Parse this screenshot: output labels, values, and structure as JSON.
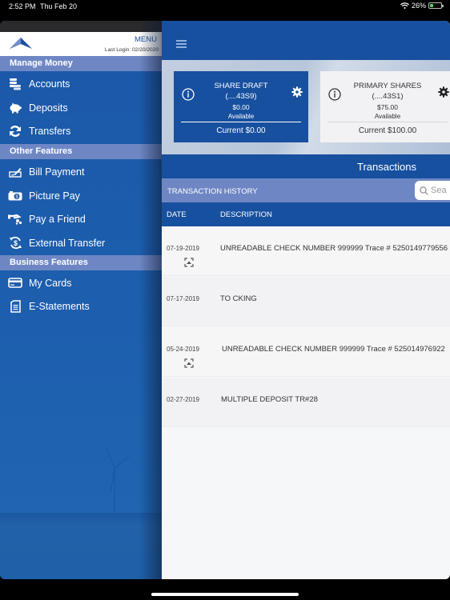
{
  "status_bar": {
    "time": "2:52 PM",
    "date": "Thu Feb 20",
    "battery_percent": "26%",
    "battery_level": 0.26,
    "icons": [
      "wifi-icon",
      "battery-charging-icon"
    ]
  },
  "sidebar": {
    "menu_label": "MENU",
    "last_login": "Last Login:  02/20/2020",
    "sections": [
      {
        "title": "Manage Money",
        "items": [
          {
            "label": "Accounts",
            "icon": "coins-stack-icon"
          },
          {
            "label": "Deposits",
            "icon": "piggy-bank-icon"
          },
          {
            "label": "Transfers",
            "icon": "sync-arrows-icon"
          }
        ]
      },
      {
        "title": "Other Features",
        "items": [
          {
            "label": "Bill Payment",
            "icon": "signing-check-icon"
          },
          {
            "label": "Picture Pay",
            "icon": "camera-money-icon"
          },
          {
            "label": "Pay a Friend",
            "icon": "hand-coins-icon"
          },
          {
            "label": "External Transfer",
            "icon": "dollar-cycle-icon"
          }
        ]
      },
      {
        "title": "Business Features",
        "items": [
          {
            "label": "My Cards",
            "icon": "credit-card-icon"
          },
          {
            "label": "E-Statements",
            "icon": "document-icon"
          }
        ]
      }
    ]
  },
  "main": {
    "menu_icon": "hamburger-icon",
    "accounts": [
      {
        "name": "SHARE DRAFT",
        "number": "(....43S9)",
        "available_amount": "$0.00",
        "available_label": "Available",
        "current": "Current $0.00",
        "selected": true
      },
      {
        "name": "PRIMARY SHARES",
        "number": "(....43S1)",
        "available_amount": "$75.00",
        "available_label": "Available",
        "current": "Current $100.00",
        "selected": false
      }
    ],
    "transactions_title": "Transactions",
    "history_label": "TRANSACTION HISTORY",
    "search_placeholder": "Search",
    "search_visible_text": "Sea",
    "columns": {
      "date": "DATE",
      "description": "DESCRIPTION"
    },
    "rows": [
      {
        "date": "07-19-2019",
        "description": "UNREADABLE CHECK NUMBER 999999 Trace # 5250149779556",
        "has_image": true
      },
      {
        "date": "07-17-2019",
        "description": "TO CKING",
        "has_image": false
      },
      {
        "date": "05-24-2019",
        "description": "UNREADABLE CHECK NUMBER 999999 Trace # 525014976922",
        "has_image": true
      },
      {
        "date": "02-27-2019",
        "description": "MULTIPLE DEPOSIT TR#28",
        "has_image": false
      }
    ]
  },
  "colors": {
    "brand_blue": "#17509f",
    "section_blue": "#6e87c4",
    "card_inactive": "#f2f2f4"
  }
}
